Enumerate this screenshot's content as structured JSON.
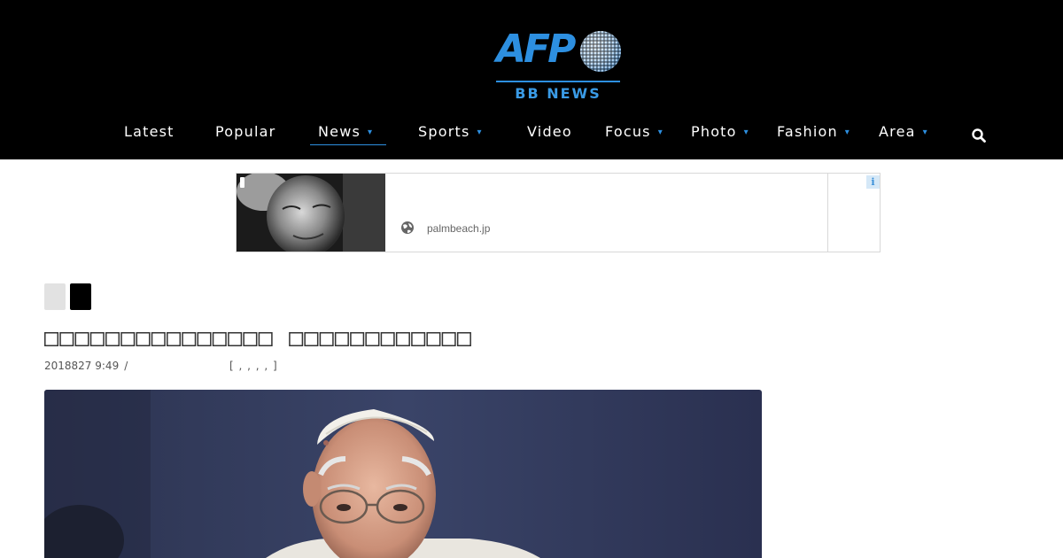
{
  "brand": {
    "logo_word": "AFP",
    "logo_sub": "BB NEWS",
    "colors": {
      "header_bg": "#000000",
      "accent": "#2d8fe0"
    }
  },
  "nav": {
    "items": [
      {
        "label": "Latest",
        "has_dropdown": false
      },
      {
        "label": "Popular",
        "has_dropdown": false
      },
      {
        "label": "News",
        "has_dropdown": true,
        "active": true
      },
      {
        "label": "Sports",
        "has_dropdown": true
      },
      {
        "label": "Video",
        "has_dropdown": false
      },
      {
        "label": "Focus",
        "has_dropdown": true
      },
      {
        "label": "Photo",
        "has_dropdown": true
      },
      {
        "label": "Fashion",
        "has_dropdown": true
      },
      {
        "label": "Area",
        "has_dropdown": true
      }
    ],
    "dropdown_glyph": "▾",
    "search_icon": "search-icon"
  },
  "ad": {
    "domain": "palmbeach.jp",
    "info_glyph": "i",
    "icons": [
      "globe-icon",
      "adchoices-icon"
    ]
  },
  "article": {
    "title": "□□□□□□□□□□□□□□□ □□□□□□□□□□□□",
    "date": "2018827 9:49",
    "separator": "/",
    "tags": "[ , , , , ]",
    "share_buttons": [
      "share-button-light",
      "share-button-dark"
    ]
  }
}
